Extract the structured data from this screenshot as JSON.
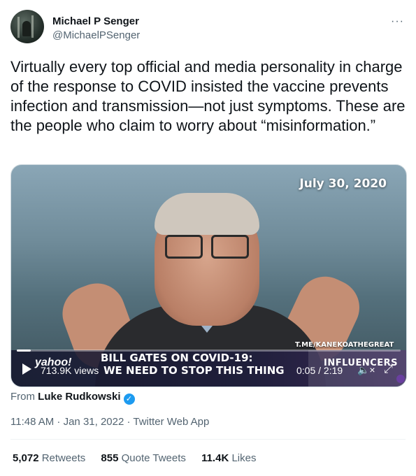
{
  "author": {
    "name": "Michael P Senger",
    "handle": "@MichaelPSenger"
  },
  "more_menu": "···",
  "tweet": {
    "text": "Virtually every top official and media personality in charge of the response to COVID insisted the vaccine prevents infection and transmission—not just symptoms. These are the people who claim to worry about “misinformation.”"
  },
  "video": {
    "date_overlay": "July 30, 2020",
    "channel": "T.ME/KANEKOATHEGREAT",
    "yahoo_logo": "yahoo!",
    "headline": "BILL GATES ON COVID-19:",
    "subheadline": "WE NEED TO STOP THIS THING",
    "influencers": "INFLUENCERS",
    "views": "713.9K views",
    "time": "0:05 / 2:19",
    "progress_fraction": 0.036,
    "mute_icon": "speaker-muted-icon",
    "fullscreen_icon": "expand-icon"
  },
  "attribution": {
    "prefix": "From",
    "source": "Luke Rudkowski"
  },
  "meta": "11:48 AM · Jan 31, 2022 · Twitter Web App",
  "stats": {
    "retweets_count": "5,072",
    "retweets_label": "Retweets",
    "quotes_count": "855",
    "quotes_label": "Quote Tweets",
    "likes_count": "11.4K",
    "likes_label": "Likes"
  },
  "colors": {
    "text_primary": "#0f1419",
    "text_secondary": "#536471",
    "verified": "#1d9bf0"
  }
}
